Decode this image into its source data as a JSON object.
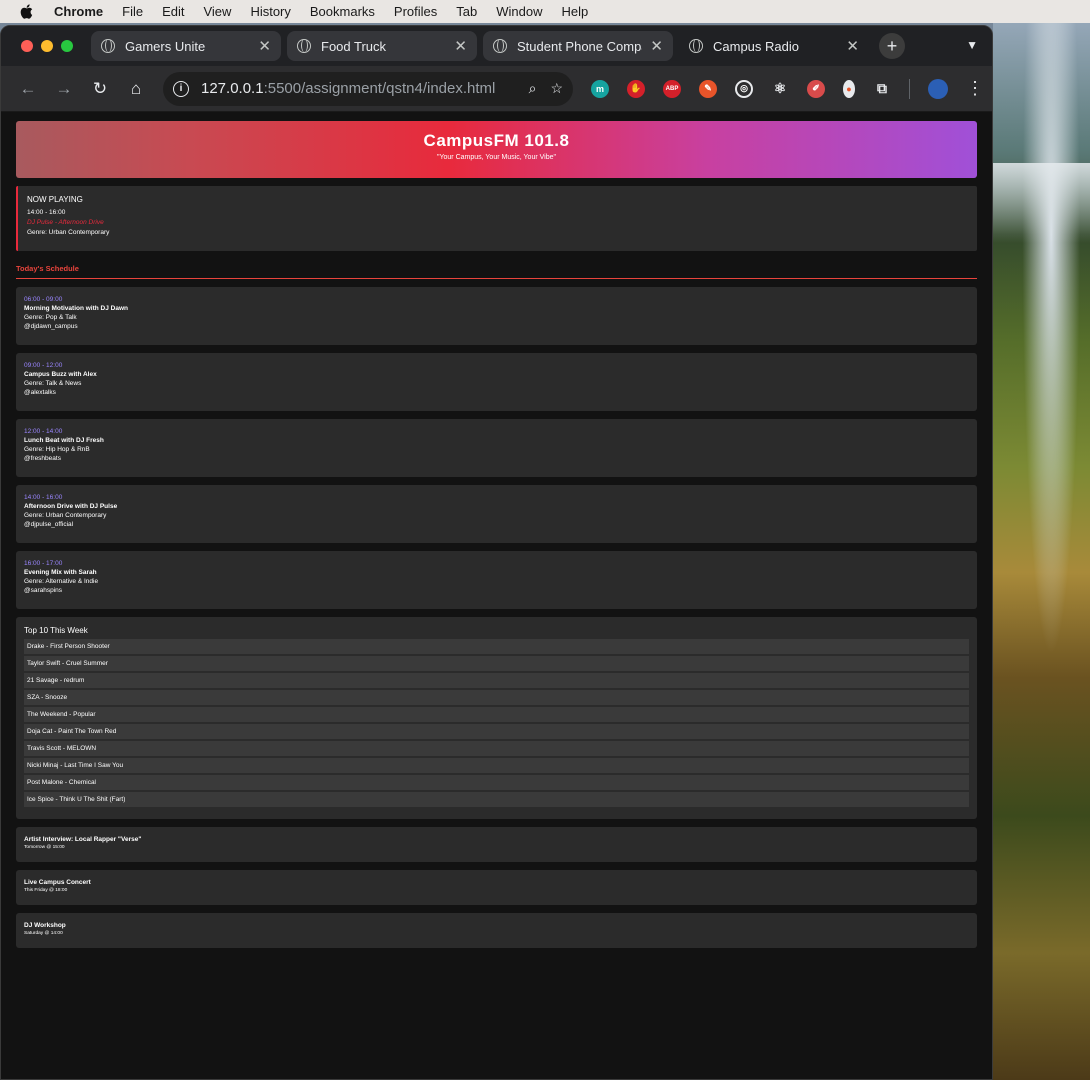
{
  "menubar": {
    "app": "Chrome",
    "items": [
      "File",
      "Edit",
      "View",
      "History",
      "Bookmarks",
      "Profiles",
      "Tab",
      "Window",
      "Help"
    ]
  },
  "browser": {
    "tabs": [
      {
        "title": "Gamers Unite"
      },
      {
        "title": "Food Truck"
      },
      {
        "title": "Student Phone Compa"
      },
      {
        "title": "Campus Radio"
      }
    ],
    "url_host": "127.0.0.1",
    "url_path": ":5500/assignment/qstn4/index.html"
  },
  "colors": {
    "accent_red": "#e82a3c",
    "accent_purple": "#9a86ff",
    "card": "#2b2b2b",
    "background": "#121212"
  },
  "header": {
    "brand": "CampusFM 101.8",
    "tagline": "\"Your Campus, Your Music, Your Vibe\""
  },
  "now_playing": {
    "heading": "NOW PLAYING",
    "time": "14:00 - 16:00",
    "show": "DJ Pulse - Afternoon Drive",
    "genre": "Genre: Urban Contemporary"
  },
  "schedule": {
    "title": "Today's Schedule",
    "shows": [
      {
        "time": "06:00 - 09:00",
        "name": "Morning Motivation with DJ Dawn",
        "genre": "Genre: Pop & Talk",
        "handle": "@djdawn_campus"
      },
      {
        "time": "09:00 - 12:00",
        "name": "Campus Buzz with Alex",
        "genre": "Genre: Talk & News",
        "handle": "@alextalks"
      },
      {
        "time": "12:00 - 14:00",
        "name": "Lunch Beat with DJ Fresh",
        "genre": "Genre: Hip Hop & RnB",
        "handle": "@freshbeats"
      },
      {
        "time": "14:00 - 16:00",
        "name": "Afternoon Drive with DJ Pulse",
        "genre": "Genre: Urban Contemporary",
        "handle": "@djpulse_official"
      },
      {
        "time": "16:00 - 17:00",
        "name": "Evening Mix with Sarah",
        "genre": "Genre: Alternative & Indie",
        "handle": "@sarahspins"
      }
    ]
  },
  "top10": {
    "title": "Top 10 This Week",
    "tracks": [
      "Drake - First Person Shooter",
      "Taylor Swift - Cruel Summer",
      "21 Savage - redrum",
      "SZA - Snooze",
      "The Weekend - Popular",
      "Doja Cat - Paint The Town Red",
      "Travis Scott - MELOWN",
      "Nicki Minaj - Last Time I Saw You",
      "Post Malone - Chemical",
      "Ice Spice - Think U The Shit (Fart)"
    ]
  },
  "events": [
    {
      "title": "Artist Interview: Local Rapper \"Verse\"",
      "when": "Tomorrow @ 15:00"
    },
    {
      "title": "Live Campus Concert",
      "when": "This Friday @ 18:00"
    },
    {
      "title": "DJ Workshop",
      "when": "Saturday @ 14:00"
    }
  ]
}
